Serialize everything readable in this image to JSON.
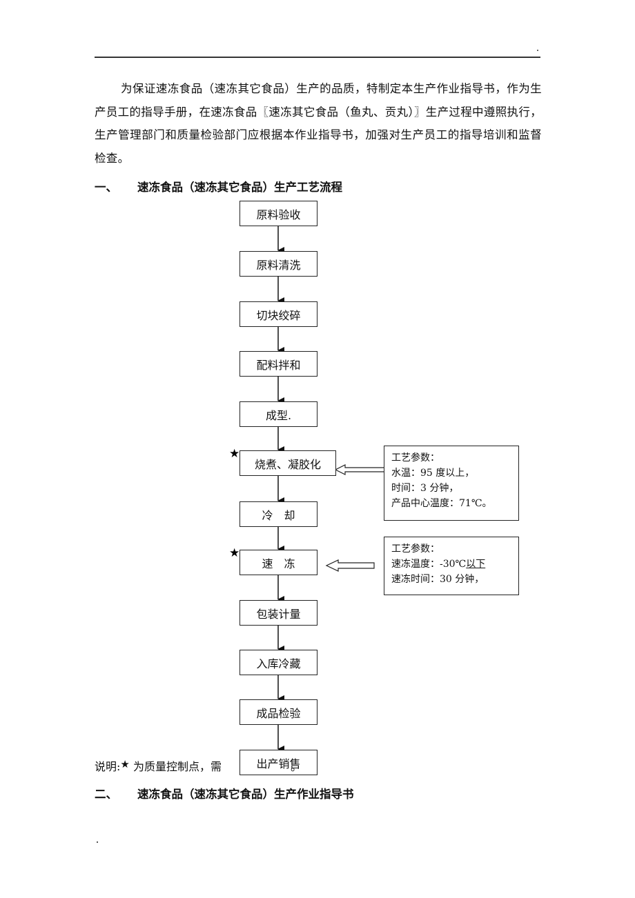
{
  "header": {
    "mark": "."
  },
  "intro": "为保证速冻食品（速冻其它食品）生产的品质，特制定本生产作业指导书，作为生产员工的指导手册，在速冻食品〖速冻其它食品（鱼丸、贡丸）〗生产过程中遵照执行，生产管理部门和质量检验部门应根据本作业指导书，加强对生产员工的指导培训和监督检查。",
  "section1": {
    "num": "一、",
    "title": "速冻食品（速冻其它食品）生产工艺流程"
  },
  "flow": {
    "steps": [
      {
        "label": "原料验收",
        "control_point": false
      },
      {
        "label": "原料清洗",
        "control_point": false
      },
      {
        "label": "切块绞碎",
        "control_point": false
      },
      {
        "label": "配料拌和",
        "control_point": false
      },
      {
        "label": "成型.",
        "control_point": false
      },
      {
        "label": "烧煮、凝胶化",
        "control_point": true
      },
      {
        "label": "冷　却",
        "control_point": false
      },
      {
        "label": "速　冻",
        "control_point": true
      },
      {
        "label": "包装计量",
        "control_point": false
      },
      {
        "label": "入库冷藏",
        "control_point": false
      },
      {
        "label": "成品检验",
        "control_point": false
      },
      {
        "label": "出产销售",
        "control_point": false
      }
    ],
    "star_symbol": "★",
    "params": [
      {
        "title": "工艺参数：",
        "lines": [
          "水温：95 度以上，",
          "时间：3 分钟，",
          "产品中心温度：71℃。"
        ]
      },
      {
        "title": "工艺参数：",
        "line1_prefix": "速冻温度：-30℃",
        "line1_underlined": "以下",
        "lines": [
          "速冻时间：30 分钟，"
        ]
      }
    ]
  },
  "note": {
    "prefix": "说明:",
    "star": "★",
    "text": " 为质量控制点，需",
    "suffix": "。"
  },
  "section2": {
    "num": "二、",
    "title": "速冻食品（速冻其它食品）生产作业指导书"
  }
}
